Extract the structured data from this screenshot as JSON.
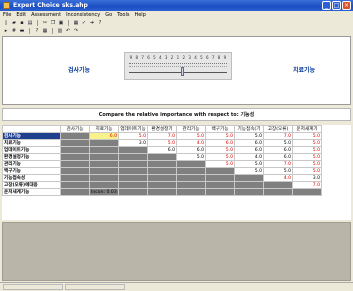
{
  "window": {
    "title": "Expert Choice   sks.ahp"
  },
  "menu": [
    "File",
    "Edit",
    "Assessment",
    "Inconsistency",
    "Go",
    "Tools",
    "Help"
  ],
  "toolbar1": [
    "new-icon",
    "open-icon",
    "save-icon",
    "print-icon",
    "cut-icon",
    "copy-icon",
    "paste-icon",
    "chart-icon",
    "check-icon",
    "arrow-icon",
    "help-icon"
  ],
  "toolbar2": [
    "verbal-icon",
    "numeric-icon",
    "graphic-icon",
    "question-icon",
    "matrix-icon",
    "grid-icon",
    "undo-icon",
    "redo-icon"
  ],
  "compare": {
    "left_item": "검사기능",
    "right_item": "치료기능",
    "scale_numbers": [
      "9",
      "8",
      "7",
      "6",
      "5",
      "4",
      "3",
      "2",
      "1",
      "2",
      "3",
      "4",
      "5",
      "6",
      "7",
      "8",
      "9"
    ]
  },
  "prompt": "Compare the relative importance with respect to: 기능성",
  "matrix": {
    "columns": [
      "검사기능",
      "치료기능",
      "업데이트기능",
      "환경설정기",
      "관리기능",
      "백구기능",
      "기능접속(기",
      "고장(오류)",
      "운저새계기"
    ],
    "rows": [
      {
        "label": "검사기능",
        "values": [
          "6.0",
          "5.0",
          "7.0",
          "5.0",
          "5.0",
          "5.0",
          "7.0",
          "5.0"
        ],
        "colors": [
          "sel",
          "red",
          "red",
          "red",
          "red",
          "blk",
          "red",
          "red"
        ]
      },
      {
        "label": "치료기능",
        "values": [
          "3.0",
          "5.0",
          "4.0",
          "6.0",
          "6.0",
          "5.0",
          "5.0"
        ],
        "colors": [
          "blk",
          "red",
          "red",
          "red",
          "blk",
          "blk",
          "red"
        ]
      },
      {
        "label": "업데이트기능",
        "values": [
          "6.0",
          "6.0",
          "5.0",
          "6.0",
          "6.0",
          "5.0"
        ],
        "colors": [
          "blk",
          "blk",
          "red",
          "blk",
          "blk",
          "red"
        ]
      },
      {
        "label": "환경설정기능",
        "values": [
          "5.0",
          "5.0",
          "4.0",
          "6.0",
          "5.0"
        ],
        "colors": [
          "blk",
          "red",
          "blk",
          "blk",
          "red"
        ]
      },
      {
        "label": "관리기능",
        "values": [
          "5.0",
          "5.0",
          "7.0",
          "5.0"
        ],
        "colors": [
          "red",
          "blk",
          "red",
          "red"
        ]
      },
      {
        "label": "백구기능",
        "values": [
          "5.0",
          "5.0",
          "5.0"
        ],
        "colors": [
          "blk",
          "blk",
          "red"
        ]
      },
      {
        "label": "기능접속성",
        "values": [
          "4.0",
          "3.0"
        ],
        "colors": [
          "red",
          "blk"
        ]
      },
      {
        "label": "고장(오류)에대응",
        "values": [
          "7.0"
        ],
        "colors": [
          "red"
        ]
      },
      {
        "label": "운저새계기능",
        "values": [],
        "colors": []
      }
    ],
    "inconsistency_text": "Incon: 0.03"
  }
}
